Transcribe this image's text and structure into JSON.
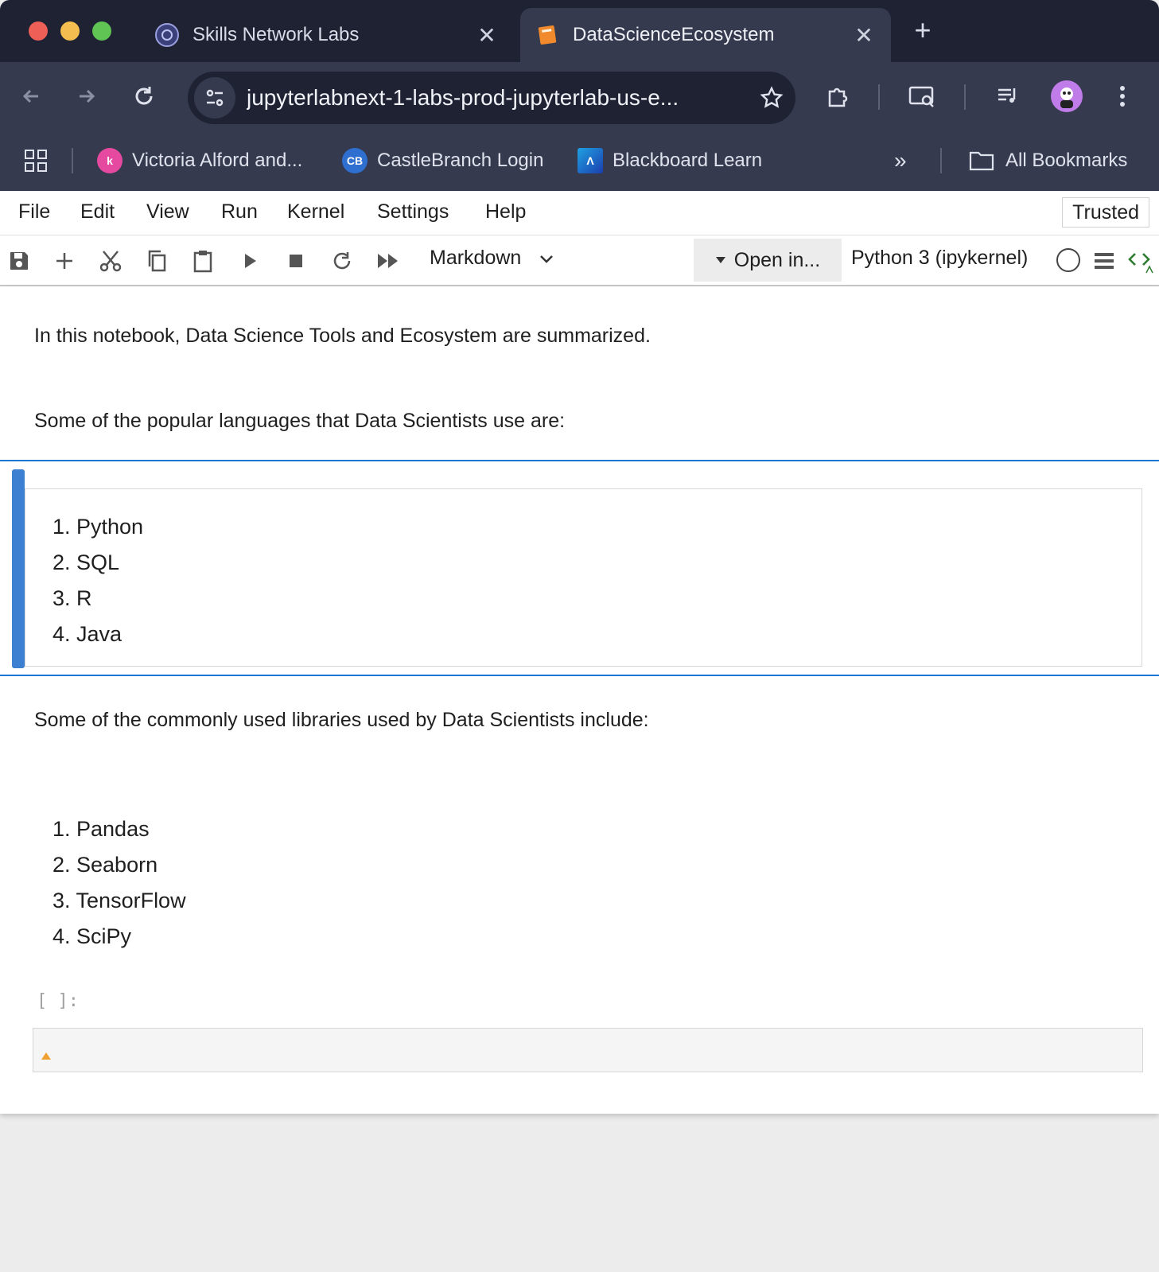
{
  "browser": {
    "tabs": [
      {
        "title": "Skills Network Labs",
        "favicon": "skills-network-icon",
        "active": false
      },
      {
        "title": "DataScienceEcosystem",
        "favicon": "notebook-icon",
        "active": true
      }
    ],
    "url": "jupyterlabnext-1-labs-prod-jupyterlab-us-e...",
    "bookmarks": [
      {
        "label": "Victoria Alford and...",
        "icon": "victoria-icon",
        "color": "#e64aa0"
      },
      {
        "label": "CastleBranch Login",
        "icon": "castlebranch-icon",
        "color": "#2f6fd0"
      },
      {
        "label": "Blackboard Learn",
        "icon": "blackboard-icon",
        "color": "#1a6ee0"
      }
    ],
    "all_bookmarks": "All Bookmarks"
  },
  "menubar": {
    "items": [
      "File",
      "Edit",
      "View",
      "Run",
      "Kernel",
      "Settings",
      "Help"
    ],
    "trusted": "Trusted"
  },
  "toolbar": {
    "cell_type": "Markdown",
    "open_in": "Open in...",
    "kernel": "Python 3 (ipykernel)"
  },
  "notebook": {
    "intro": "In this notebook, Data Science Tools and Ecosystem are summarized.",
    "languages_heading": "Some of the popular languages that Data Scientists use are:",
    "languages": [
      "1. Python",
      "2. SQL",
      "3. R",
      "4. Java"
    ],
    "libraries_heading": "Some of the commonly used libraries used by Data Scientists include:",
    "libraries": [
      "1. Pandas",
      "2. Seaborn",
      "3. TensorFlow",
      "4. SciPy"
    ],
    "code_prompt": "[ ]:"
  }
}
